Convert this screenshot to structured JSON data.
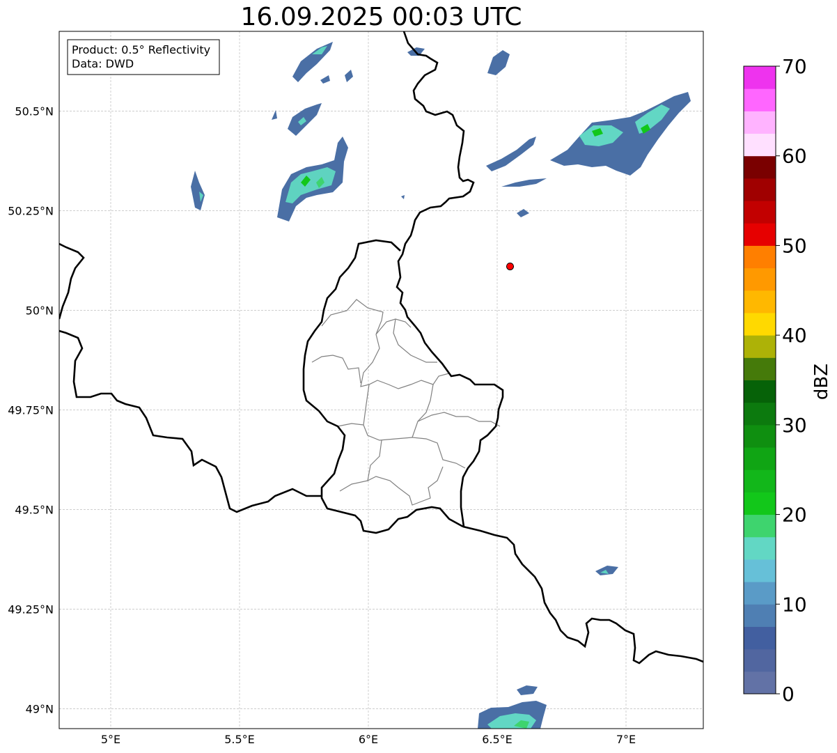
{
  "title": "16.09.2025 00:03 UTC",
  "info_box": {
    "line1": "Product: 0.5° Reflectivity",
    "line2": "Data: DWD"
  },
  "map": {
    "lon_range": [
      4.8,
      7.3
    ],
    "lat_range": [
      48.95,
      50.7
    ],
    "lon_ticks": [
      {
        "value": 5.0,
        "label": "5°E"
      },
      {
        "value": 5.5,
        "label": "5.5°E"
      },
      {
        "value": 6.0,
        "label": "6°E"
      },
      {
        "value": 6.5,
        "label": "6.5°E"
      },
      {
        "value": 7.0,
        "label": "7°E"
      }
    ],
    "lat_ticks": [
      {
        "value": 50.5,
        "label": "50.5°N"
      },
      {
        "value": 50.25,
        "label": "50.25°N"
      },
      {
        "value": 50.0,
        "label": "50°N"
      },
      {
        "value": 49.75,
        "label": "49.75°N"
      },
      {
        "value": 49.5,
        "label": "49.5°N"
      },
      {
        "value": 49.25,
        "label": "49.25°N"
      },
      {
        "value": 49.0,
        "label": "49°N"
      }
    ],
    "gridlines": true,
    "marker": {
      "lon": 6.55,
      "lat": 50.11,
      "color": "#ff0000"
    },
    "echo_color_low": "#4a6fa5",
    "echo_color_mid": "#5fd3c0",
    "echo_color_high": "#1ec81e"
  },
  "colorbar": {
    "label": "dBZ",
    "min": 0,
    "max": 70,
    "tick_values": [
      0,
      10,
      20,
      30,
      40,
      50,
      60,
      70
    ],
    "colors": [
      "#6272a6",
      "#5166a0",
      "#425fa0",
      "#4f7fb3",
      "#5a9bc7",
      "#66c0d8",
      "#62d7c4",
      "#3ed46e",
      "#12c71a",
      "#12b71a",
      "#10a514",
      "#0f8f10",
      "#0c7a0e",
      "#066208",
      "#457a0a",
      "#adb207",
      "#ffd900",
      "#ffb800",
      "#ff9900",
      "#ff7f00",
      "#e60000",
      "#c20000",
      "#a00000",
      "#7a0000",
      "#ffe0ff",
      "#ffb3ff",
      "#ff66ff",
      "#ee33ee"
    ]
  }
}
